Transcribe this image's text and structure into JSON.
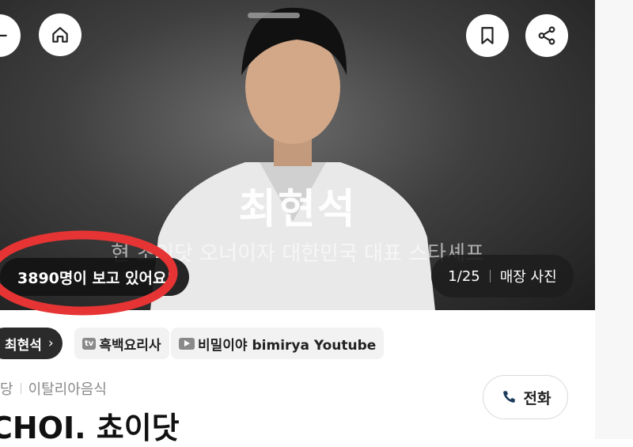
{
  "hero": {
    "title": "최현석",
    "subtitle": "현 초이닷 오너이자 대한민국 대표 스타셰프",
    "viewers": "3890명이 보고 있어요!",
    "counter": "1/25",
    "counter_label": "매장 사진"
  },
  "chips": {
    "chef": "최현석",
    "show_icon": "tv",
    "show": "흑백요리사",
    "youtube": "비밀이야 bimirya Youtube"
  },
  "store": {
    "category_prefix": "당",
    "category": "이탈리아음식",
    "name": "CHOI. 쵸이닷",
    "call_label": "전화"
  },
  "colors": {
    "annotation": "#e63434",
    "dark_pill": "#2b2b2b"
  }
}
